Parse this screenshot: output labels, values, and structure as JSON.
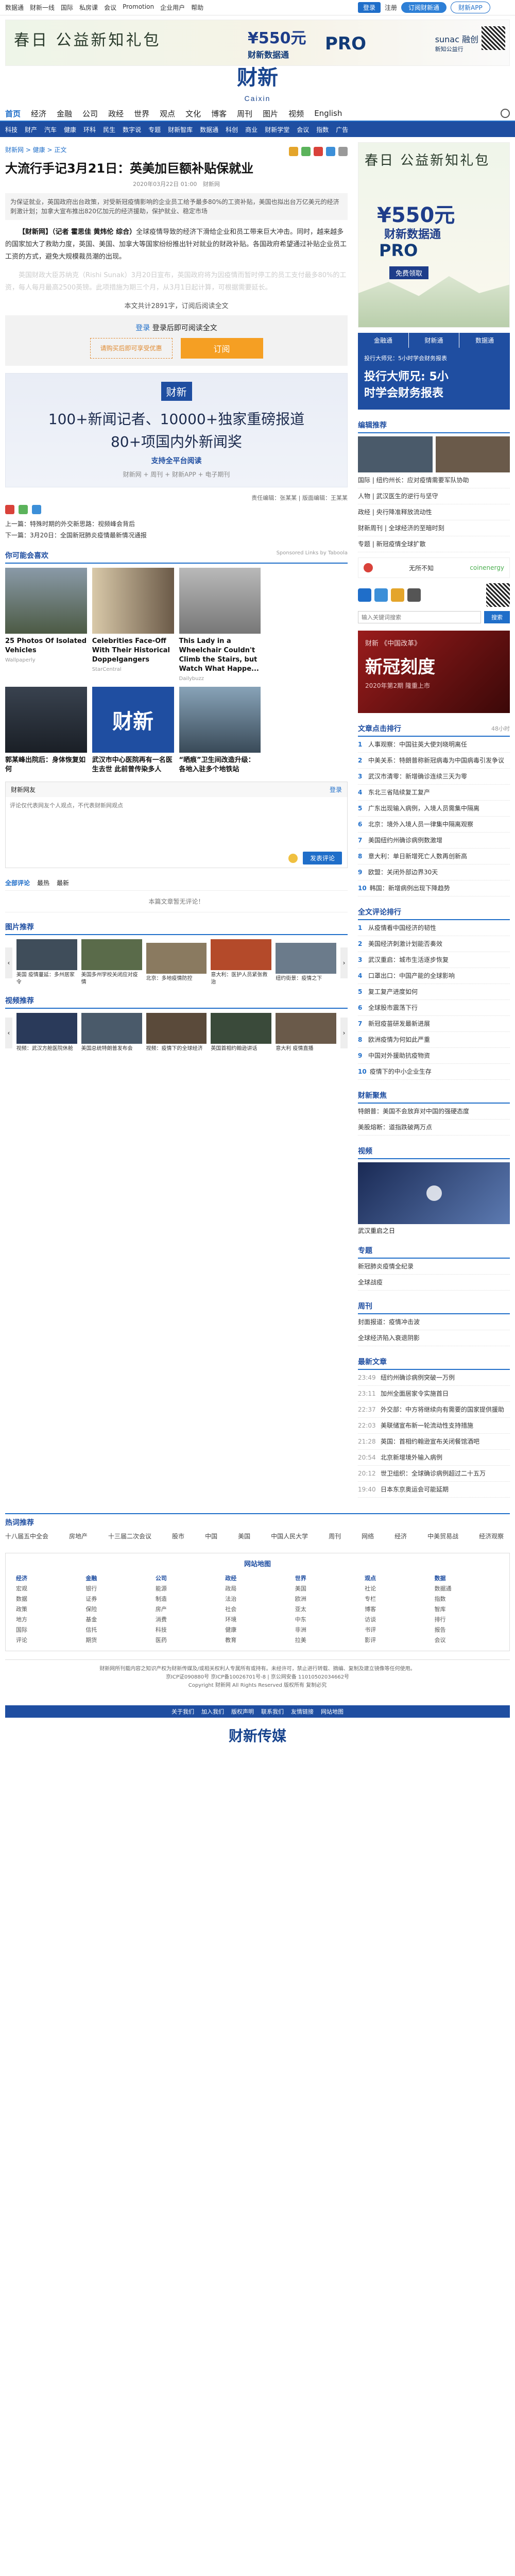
{
  "topbar": {
    "links": [
      "数据通",
      "财新一线",
      "国际",
      "私房课",
      "会议",
      "Promotion",
      "企业用户",
      "帮助"
    ],
    "login": "登录",
    "register": "注册",
    "subscribe": "订阅财新通",
    "app": "财新APP"
  },
  "top_ad": {
    "title": "春日 公益新知礼包",
    "mid_price": "¥550元",
    "mid_text": "财新数据通",
    "pro": "PRO",
    "sub": "sunac 融创",
    "sub2": "新知公益行"
  },
  "logo": {
    "cn": "财新",
    "en": "Caixin",
    "slogan": ""
  },
  "nav": {
    "items": [
      "首页",
      "经济",
      "金融",
      "公司",
      "政经",
      "世界",
      "观点",
      "文化",
      "博客",
      "周刊",
      "图片",
      "视频",
      "English"
    ],
    "active": "首页"
  },
  "subnav": [
    "科技",
    "财产",
    "汽车",
    "健康",
    "环科",
    "民生",
    "数字说",
    "专题",
    "财新智库",
    "数据通",
    "科创",
    "商业",
    "财新学堂",
    "会议",
    "指数",
    "广告"
  ],
  "article": {
    "crumb": "财新网 > 健康 > 正文",
    "title": "大流行手记3月21日：英美加巨额补贴保就业",
    "meta_date": "2020年03月22日 01:00",
    "meta_source": "财新网",
    "summary": "为保证就业，英国政府出台政策，对受新冠疫情影响的企业员工给予最多80%的工资补贴，美国也拟出台万亿美元的经济刺激计划；加拿大宣布推出820亿加元的经济援助，保护就业、稳定市场",
    "p1_lead": "【财新网】（记者 霍思佳 黄炜伦 综合）",
    "p1": "全球疫情导致的经济下滑给企业和员工带来巨大冲击。同时，越来越多的国家加大了救助力度，英国、美国、加拿大等国家纷纷推出针对就业的财政补贴。各国政府希望通过补贴企业员工工资的方式，避免大规模裁员潮的出现。",
    "p2": "英国财政大臣苏纳克（Rishi Sunak）3月20日宣布，英国政府将为因疫情而暂时停工的员工支付最多80%的工资，每人每月最高2500英镑。此项措施为期三个月，从3月1日起计算，可根据需要延长。",
    "pay_note": "本文共计2891字，订阅后阅读全文",
    "login_prompt": "登录后即可阅读全文",
    "coupon": "请购买后即可享受优惠",
    "order": "订阅",
    "editor": "责任编辑：张某某 | 版面编辑：王某某"
  },
  "promo": {
    "logo": "财新",
    "l1": "100+新闻记者、10000+独家重磅报道",
    "l2": "80+项国内外新闻奖",
    "l3": "支持全平台阅读",
    "l4": "财新网 + 周刊 + 财新APP + 电子期刊"
  },
  "prevnext": {
    "prev": "上一篇：特殊时期的外交新思路：视频峰会背后",
    "next": "下一篇：3月20日：全国新冠肺炎疫情最新情况通报"
  },
  "recommend": {
    "title": "你可能会喜欢",
    "sponsor": "Sponsored Links by Taboola",
    "cards": [
      {
        "cap": "25 Photos Of Isolated Vehicles",
        "src": "Wallpaperly"
      },
      {
        "cap": "Celebrities Face-Off With Their Historical Doppelgangers",
        "src": "StarCentral"
      },
      {
        "cap": "This Lady in a Wheelchair Couldn't Climb the Stairs, but Watch What Happe...",
        "src": "Dailybuzz"
      },
      {
        "cap": "",
        "src": ""
      },
      {
        "cap": "郭某峰出院后：身体恢复如何",
        "src": ""
      },
      {
        "cap": "武汉市中心医院再有一名医生去世 此前曾传染多人",
        "src": ""
      },
      {
        "cap": "“晒痕”卫生间改造升级：各地入驻多个地铁站",
        "src": ""
      },
      {
        "cap": "",
        "src": ""
      }
    ]
  },
  "comment": {
    "title": "财新网友",
    "login": "登录",
    "placeholder": "评论仅代表网友个人观点，不代表财新网观点",
    "submit": "发表评论",
    "tabs": [
      "全部评论",
      "最热",
      "最新"
    ],
    "empty": "本篇文章暂无评论！"
  },
  "photo_section": {
    "title": "图片推荐",
    "items": [
      "美国 疫情蔓延：多州居家令",
      "美国多州学校关闭应对疫情",
      "北京：多地疫情防控",
      "意大利：医护人员紧张救治",
      "纽约街景：疫情之下"
    ]
  },
  "video_section": {
    "title": "视频推荐",
    "items": [
      "视频：武汉方舱医院休舱",
      "美国总统特朗普发布会",
      "视频：疫情下的全球经济",
      "英国首相约翰逊讲话",
      "意大利 疫情直播"
    ]
  },
  "right": {
    "ad_title": "春日 公益新知礼包",
    "ad_price": "¥550元",
    "ad_name": "财新数据通",
    "ad_pro": "PRO",
    "ad_btn": "免费领取",
    "tabs": [
      "金融通",
      "财新通",
      "数据通"
    ],
    "tab_promo_a": "投行大师兄：5小时学会财务报表",
    "tab_promo_b": "投行大师兄: 5小",
    "tab_promo_c": "时学会财务报表",
    "editor_pick_title": "编辑推荐",
    "editor_pick": [
      "国际 | 纽约州长：应对疫情需要军队协助",
      "人物 | 武汉医生的逆行与坚守",
      "政经 | 央行降准释放流动性",
      "财新周刊 | 全球经济的至暗时刻",
      "专题 | 新冠疫情全球扩散"
    ],
    "app_label": "无所不知",
    "search_placeholder": "输入关键词搜索",
    "search_btn": "搜索",
    "red_a": "财新 《中国改革》",
    "red_b": "新冠刻度",
    "red_c": "2020年第2期 隆重上市",
    "hot_title": "文章点击排行",
    "hot_tab": "48小时",
    "hot_list": [
      "人事观察：中国驻英大使刘晓明离任",
      "中美关系：特朗普称新冠病毒为中国病毒引发争议",
      "武汉市清零：新增确诊连续三天为零",
      "东北三省陆续复工复产",
      "广东出现输入病例，入境人员需集中隔离",
      "北京：境外入境人员一律集中隔离观察",
      "美国纽约州确诊病例数激增",
      "意大利：单日新增死亡人数再创新高",
      "欧盟：关闭外部边界30天",
      "韩国：新增病例出现下降趋势"
    ],
    "comment_rank_title": "全文评论排行",
    "comment_rank": [
      "从疫情看中国经济的韧性",
      "美国经济刺激计划能否奏效",
      "武汉重启：城市生活逐步恢复",
      "口罩出口：中国产能的全球影响",
      "复工复产进度如何",
      "全球股市震荡下行",
      "新冠疫苗研发最新进展",
      "欧洲疫情为何如此严重",
      "中国对外援助抗疫物资",
      "疫情下的中小企业生存"
    ],
    "fx_title": "财新聚焦",
    "fx_items": [
      "特朗普：美国不会放弃对中国的强硬态度",
      "美股熔断：道指跌破两万点"
    ],
    "video_title": "视频",
    "video_caption": "武汉重启之日",
    "special_title": "专题",
    "special_items": [
      "新冠肺炎疫情全纪录",
      "全球战疫"
    ],
    "week_title": "周刊",
    "week_items": [
      "封面报道：疫情冲击波",
      "全球经济陷入衰退阴影"
    ],
    "latest_title": "最新文章",
    "latest": [
      {
        "t": "23:49",
        "s": "纽约州确诊病例突破一万例"
      },
      {
        "t": "23:11",
        "s": "加州全面居家令实施首日"
      },
      {
        "t": "22:37",
        "s": "外交部：中方将继续向有需要的国家提供援助"
      },
      {
        "t": "22:03",
        "s": "美联储宣布新一轮流动性支持措施"
      },
      {
        "t": "21:28",
        "s": "英国：首相约翰逊宣布关闭餐馆酒吧"
      },
      {
        "t": "20:54",
        "s": "北京新增境外输入病例"
      },
      {
        "t": "20:12",
        "s": "世卫组织：全球确诊病例超过二十五万"
      },
      {
        "t": "19:40",
        "s": "日本东京奥运会可能延期"
      }
    ]
  },
  "hotwords": {
    "title": "热词推荐",
    "items": [
      "十八届五中全会",
      "房地产",
      "十三届二次会议",
      "股市",
      "中国",
      "美国",
      "中国人民大学",
      "周刊",
      "网络",
      "经济",
      "中美贸易战",
      "经济观察"
    ]
  },
  "sitemap": {
    "title": "网站地图",
    "cols": [
      {
        "h": "经济",
        "items": [
          "宏观",
          "数据",
          "政策",
          "地方",
          "国际",
          "评论"
        ]
      },
      {
        "h": "金融",
        "items": [
          "银行",
          "证券",
          "保险",
          "基金",
          "信托",
          "期货"
        ]
      },
      {
        "h": "公司",
        "items": [
          "能源",
          "制造",
          "房产",
          "消费",
          "科技",
          "医药"
        ]
      },
      {
        "h": "政经",
        "items": [
          "政局",
          "法治",
          "社会",
          "环境",
          "健康",
          "教育"
        ]
      },
      {
        "h": "世界",
        "items": [
          "美国",
          "欧洲",
          "亚太",
          "中东",
          "非洲",
          "拉美"
        ]
      },
      {
        "h": "观点",
        "items": [
          "社论",
          "专栏",
          "博客",
          "访谈",
          "书评",
          "影评"
        ]
      },
      {
        "h": "数据",
        "items": [
          "数据通",
          "指数",
          "智库",
          "排行",
          "报告",
          "会议"
        ]
      }
    ]
  },
  "copyright": {
    "l1": "财新网所刊载内容之知识产权为财新传媒及/或相关权利人专属所有或持有。未经许可，禁止进行转载、摘编、复制及建立镜像等任何使用。",
    "l2": "京ICP证090880号 京ICP备10026701号-8 | 京公网安备 11010502034662号",
    "l3": "Copyright 财新网 All Rights Reserved 版权所有 复制必究"
  },
  "footlinks": [
    "关于我们",
    "加入我们",
    "版权声明",
    "联系我们",
    "友情链接",
    "网站地图"
  ],
  "footlogo": "财新传媒"
}
